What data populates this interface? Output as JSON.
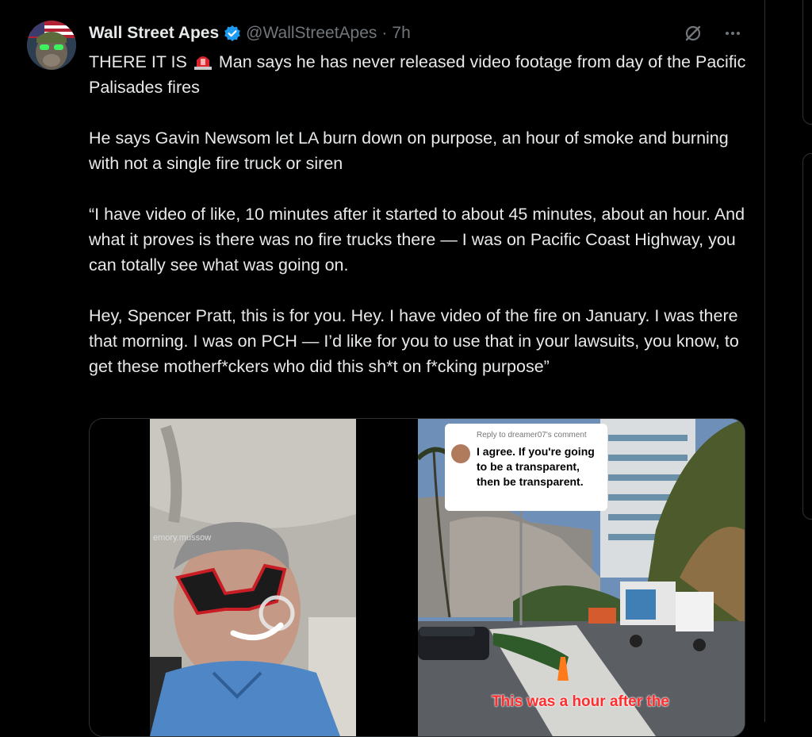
{
  "tweet": {
    "display_name": "Wall Street Apes",
    "handle": "@WallStreetApes",
    "separator": "·",
    "time": "7h",
    "paragraphs": [
      {
        "before": "THERE IT IS",
        "after": "Man says he has never released video footage from day of the Pacific Palisades fires",
        "emoji": "rotating-light-emoji"
      },
      {
        "text": "He says Gavin Newsom let LA burn down on purpose, an hour of smoke and burning with not a single fire truck or siren"
      },
      {
        "text": "“I have video of like, 10 minutes after it started to about 45 minutes, about an hour. And what it proves is there was no fire trucks there —  I was on Pacific Coast Highway, you can totally see what was going on."
      },
      {
        "text": "Hey, Spencer Pratt, this is for you. Hey. I have video of the fire on January. I was there that morning. I was on PCH — I’d like for you to use that in your lawsuits, you know, to get these motherf*ckers who did this sh*t on f*cking purpose”"
      }
    ]
  },
  "media": {
    "left_video": {
      "watermark": "emory.mussow"
    },
    "right_video": {
      "reply_label": "Reply to dreamer07's comment",
      "reply_text": "I agree. If you're going to be a transparent, then be transparent.",
      "caption": "This was a hour after the"
    }
  },
  "icons": {
    "verified": "verified-badge-icon",
    "grok": "grok-icon",
    "more": "more-horizontal-icon"
  },
  "colors": {
    "background": "#000000",
    "text": "#e7e9ea",
    "muted": "#71767b",
    "verified": "#1d9bf0",
    "caption_red": "#ff2d2d"
  }
}
